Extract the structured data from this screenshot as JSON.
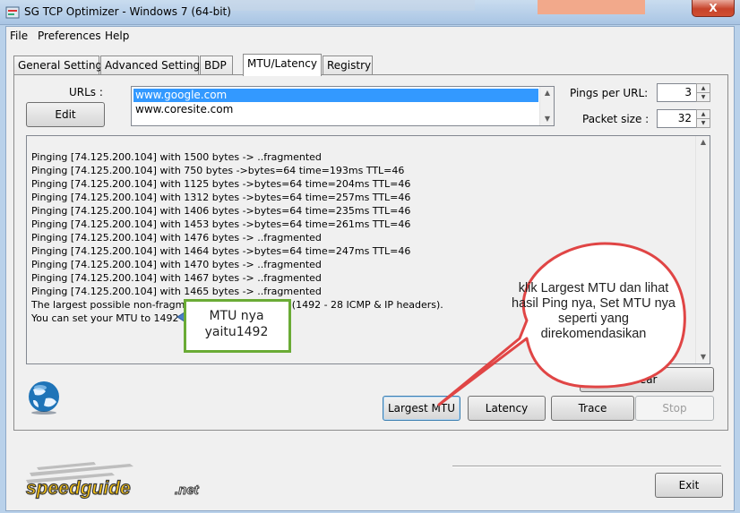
{
  "window": {
    "title": "SG TCP Optimizer - Windows 7 (64-bit)",
    "close_glyph": "X"
  },
  "menu": {
    "items": [
      "File",
      "Preferences",
      "Help"
    ]
  },
  "tabs": [
    "General Settings",
    "Advanced Settings",
    "BDP",
    "MTU/Latency",
    "Registry"
  ],
  "active_tab": "MTU/Latency",
  "urls": {
    "label": "URLs :",
    "edit_label": "Edit",
    "items": [
      "www.google.com",
      "www.coresite.com"
    ],
    "selected": "www.google.com"
  },
  "pings_per_url": {
    "label": "Pings per URL:",
    "value": "3"
  },
  "packet_size": {
    "label": "Packet size :",
    "value": "32"
  },
  "log": {
    "lines": [
      "Pinging [74.125.200.104] with 1500 bytes -> ..fragmented",
      "Pinging [74.125.200.104] with 750 bytes ->bytes=64 time=193ms TTL=46",
      "Pinging [74.125.200.104] with 1125 bytes ->bytes=64 time=204ms TTL=46",
      "Pinging [74.125.200.104] with 1312 bytes ->bytes=64 time=257ms TTL=46",
      "Pinging [74.125.200.104] with 1406 bytes ->bytes=64 time=235ms TTL=46",
      "Pinging [74.125.200.104] with 1453 bytes ->bytes=64 time=261ms TTL=46",
      "Pinging [74.125.200.104] with 1476 bytes -> ..fragmented",
      "Pinging [74.125.200.104] with 1464 bytes ->bytes=64 time=247ms TTL=46",
      "Pinging [74.125.200.104] with 1470 bytes -> ..fragmented",
      "Pinging [74.125.200.104] with 1467 bytes -> ..fragmented",
      "Pinging [74.125.200.104] with 1465 bytes -> ..fragmented",
      "The largest possible non-fragmented packet is 1464  (1492 - 28 ICMP & IP headers).",
      "You can set your MTU to 1492"
    ]
  },
  "buttons": {
    "clear": "lear",
    "largest_mtu": "Largest MTU",
    "latency": "Latency",
    "trace": "Trace",
    "stop": "Stop",
    "exit": "Exit"
  },
  "logo_text": "speedguide.net",
  "annotations": {
    "mtu_callout": "MTU nya yaitu1492",
    "bubble": "klik Largest MTU dan lihat hasil Ping nya, Set MTU nya seperti yang direkomendasikan"
  },
  "colors": {
    "selection": "#3399ff",
    "callout_border": "#6aab35",
    "bubble_border": "#e04545",
    "arrow": "#4a7ec6"
  }
}
